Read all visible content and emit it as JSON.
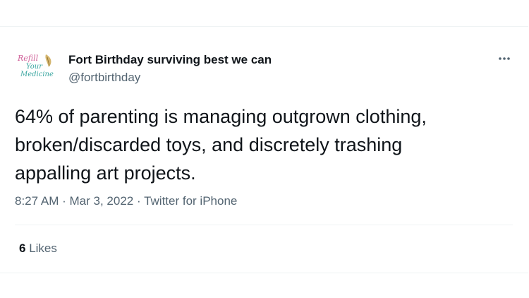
{
  "author": {
    "display_name": "Fort Birthday surviving best we can",
    "handle": "@fortbirthday",
    "avatar_logo_text": "Refill Your Medicine"
  },
  "tweet": {
    "text": "64% of parenting is managing outgrown clothing,\nbroken/discarded toys, and discretely trashing\nappalling art projects.",
    "time": "8:27 AM",
    "date": "Mar 3, 2022",
    "separator": "·",
    "source": "Twitter for iPhone"
  },
  "stats": {
    "likes_count": "6",
    "likes_label": "Likes"
  },
  "icons": {
    "more": "more-horizontal-icon"
  },
  "colors": {
    "text_primary": "#0f1419",
    "text_secondary": "#536471",
    "divider": "#eff3f4",
    "logo_teal": "#3aa6a0",
    "logo_pink": "#d0629a",
    "logo_gold": "#c9a24a"
  }
}
